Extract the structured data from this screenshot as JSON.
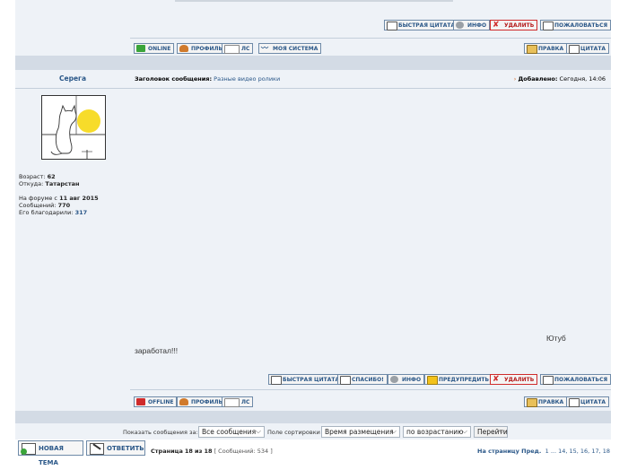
{
  "top_post": {
    "actions": [
      "БЫСТРАЯ ЦИТАТА",
      "ИНФО",
      "УДАЛИТЬ",
      "ПОЖАЛОВАТЬСЯ"
    ],
    "profile_buttons": [
      "ONLINE",
      "ПРОФИЛЬ",
      "ЛС",
      "МОЯ СИСТЕМА"
    ],
    "edit": "ПРАВКА",
    "quote": "ЦИТАТА"
  },
  "post": {
    "author": "Серега",
    "subject_label": "Заголовок сообщения:",
    "subject": "Разные видео ролики",
    "added_label": "Добавлено:",
    "added": "Сегодня, 14:06",
    "age_label": "Возраст:",
    "age": "62",
    "from_label": "Откуда:",
    "from": "Татарстан",
    "since_label": "На форуме с",
    "since": "11 авг 2015",
    "messages_label": "Сообщений:",
    "messages": "770",
    "thanked_label": "Его благодарили:",
    "thanked": "317",
    "body_right": "Ютуб",
    "body_left": "заработал!!!",
    "actions": [
      "БЫСТРАЯ ЦИТАТА",
      "СПАСИБО!",
      "ИНФО",
      "ПРЕДУПРЕДИТЬ",
      "УДАЛИТЬ",
      "ПОЖАЛОВАТЬСЯ"
    ],
    "profile_buttons": [
      "OFFLINE",
      "ПРОФИЛЬ",
      "ЛС"
    ],
    "edit": "ПРАВКА",
    "quote": "ЦИТАТА"
  },
  "filters": {
    "show_label": "Показать сообщения за:",
    "show_value": "Все сообщения",
    "sort_label": "Поле сортировки",
    "sort_value": "Время размещения",
    "order_value": "по возрастанию",
    "go": "Перейти"
  },
  "footer": {
    "new_topic": "НОВАЯ ТЕМА",
    "reply": "ОТВЕТИТЬ",
    "page_label": "Страница",
    "page_current": "18",
    "page_of": "из",
    "page_total": "18",
    "messages_info": "[ Сообщений: 534 ]",
    "goto_label": "На страницу",
    "prev": "Пред.",
    "pages": "1 ... 14, 15, 16, 17, 18"
  },
  "colors": {
    "panel": "#eef2f7",
    "link": "#2a5788",
    "separator": "#d3dbe5",
    "delete": "#cf2b2b"
  }
}
